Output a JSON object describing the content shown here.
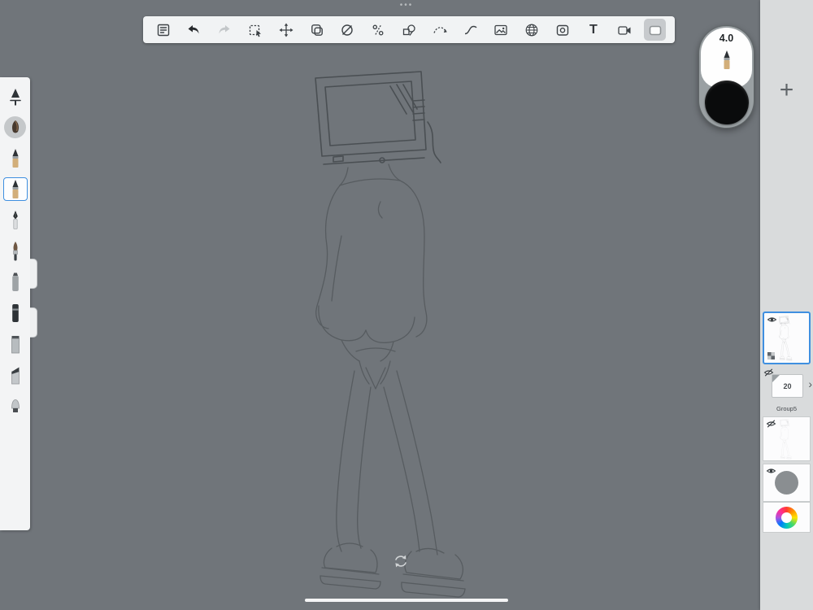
{
  "window": {
    "top_indicator_dots": "•••",
    "canvas_color": "#70757A"
  },
  "toolbar": {
    "background": "#F1F3F4",
    "text_tool_glyph": "T",
    "tools": [
      {
        "id": "menu"
      },
      {
        "id": "undo",
        "enabled": true
      },
      {
        "id": "redo",
        "enabled": false
      },
      {
        "id": "rectangle-select"
      },
      {
        "id": "move"
      },
      {
        "id": "transform"
      },
      {
        "id": "eraser"
      },
      {
        "id": "divide"
      },
      {
        "id": "shape-pen"
      },
      {
        "id": "curve-pen"
      },
      {
        "id": "curve"
      },
      {
        "id": "insert-image"
      },
      {
        "id": "mesh-transform"
      },
      {
        "id": "material"
      },
      {
        "id": "text"
      },
      {
        "id": "video"
      },
      {
        "id": "frame",
        "selected": true
      }
    ]
  },
  "brush_widget": {
    "size": "4.0",
    "current_color": "#0A0B0C"
  },
  "brush_sidebar": {
    "selected_index": 3,
    "brushes": [
      "airbrush",
      "round-brush",
      "pencil",
      "pencil-2",
      "ink-pen",
      "paint-brush",
      "marker",
      "dark-marker",
      "flat-shader",
      "angled-flat",
      "dome-brush"
    ]
  },
  "layers_panel": {
    "add_button": "+",
    "group_badge": "20",
    "group_label": "Group5",
    "group_expand": "›",
    "accent": "#3F8FE0",
    "items": [
      {
        "type": "layer",
        "visible": true,
        "selected": true
      },
      {
        "type": "group",
        "visible": false,
        "label": "Group5",
        "count": "20"
      },
      {
        "type": "layer",
        "visible": false
      },
      {
        "type": "layer",
        "visible": true
      }
    ]
  }
}
